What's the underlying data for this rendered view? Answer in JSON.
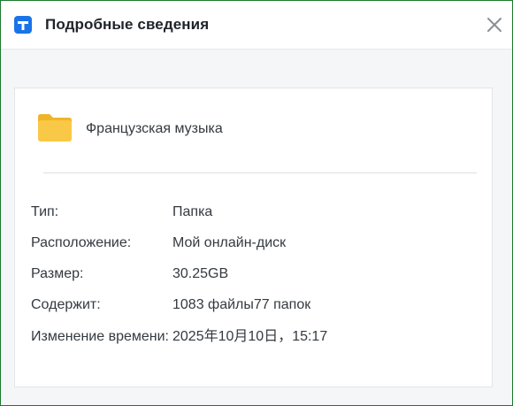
{
  "window": {
    "title": "Подробные сведения",
    "app_icon": "app-logo-icon",
    "close_icon": "close-icon"
  },
  "item": {
    "icon": "folder-icon",
    "name": "Французская музыка"
  },
  "details": [
    {
      "label": "Тип:",
      "value": "Папка"
    },
    {
      "label": "Расположение:",
      "value": "Мой онлайн-диск"
    },
    {
      "label": "Размер:",
      "value": "30.25GB"
    },
    {
      "label": "Содержит:",
      "value": "1083 файлы77 папок"
    },
    {
      "label": "Изменение времени:",
      "value": "2025年10月10日，15:17"
    }
  ],
  "colors": {
    "accent": "#1a73e8",
    "folder": "#f6c242",
    "window_border": "#1c7a2e"
  }
}
